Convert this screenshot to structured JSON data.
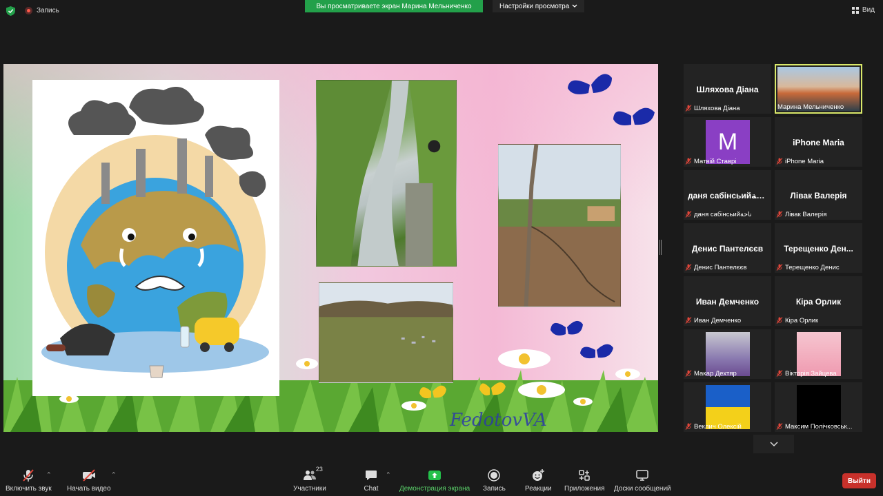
{
  "topbar": {
    "recording_label": "Запись",
    "share_banner": "Вы просматриваете экран Марина Мельниченко",
    "view_settings": "Настройки просмотра",
    "view_label": "Вид"
  },
  "shared_screen": {
    "signature": "FedotovVA"
  },
  "participants": [
    {
      "display": "Шляхова Діана",
      "caption": "Шляхова Діана",
      "type": "name",
      "muted": true
    },
    {
      "display": "",
      "caption": "Марина Мельниченко",
      "type": "video",
      "muted": false,
      "active": true
    },
    {
      "display": "M",
      "caption": "Матвій Ставрі",
      "type": "letter",
      "muted": true
    },
    {
      "display": "iPhone Maria",
      "caption": "iPhone Maria",
      "type": "name",
      "muted": true
    },
    {
      "display": "даня сабінсьий‫ خحة ",
      "caption": "даня сабінсьий‫ ناحة ",
      "type": "name",
      "muted": true
    },
    {
      "display": "Лівак Валерія",
      "caption": "Лівак Валерія",
      "type": "name",
      "muted": true
    },
    {
      "display": "Денис Пантелєєв",
      "caption": "Денис Пантелєєв",
      "type": "name",
      "muted": true
    },
    {
      "display": "Терещенко Ден...",
      "caption": "Терещенко Денис",
      "type": "name",
      "muted": true
    },
    {
      "display": "Иван Демченко",
      "caption": "Иван Демченко",
      "type": "name",
      "muted": true
    },
    {
      "display": "Кіра Орлик",
      "caption": "Кіра Орлик",
      "type": "name",
      "muted": true
    },
    {
      "display": "",
      "caption": "Макар Дехтяр",
      "type": "makar",
      "muted": true
    },
    {
      "display": "",
      "caption": "Вікторія Зайцева",
      "type": "vika",
      "muted": true
    },
    {
      "display": "",
      "caption": "Веклич Олексій",
      "type": "flag",
      "muted": true
    },
    {
      "display": "",
      "caption": "Максим Полічковськ...",
      "type": "black",
      "muted": true
    }
  ],
  "toolbar": {
    "audio_label": "Включить звук",
    "video_label": "Начать видео",
    "participants_label": "Участники",
    "participants_count": "23",
    "chat_label": "Chat",
    "share_label": "Демонстрация экрана",
    "record_label": "Запись",
    "reactions_label": "Реакции",
    "apps_label": "Приложения",
    "whiteboard_label": "Доски сообщений",
    "leave_label": "Выйти"
  },
  "colors": {
    "share_green": "#23a04a",
    "leave_red": "#c8312b",
    "active_speaker": "#d9e86a",
    "muted_red": "#e0463a"
  }
}
